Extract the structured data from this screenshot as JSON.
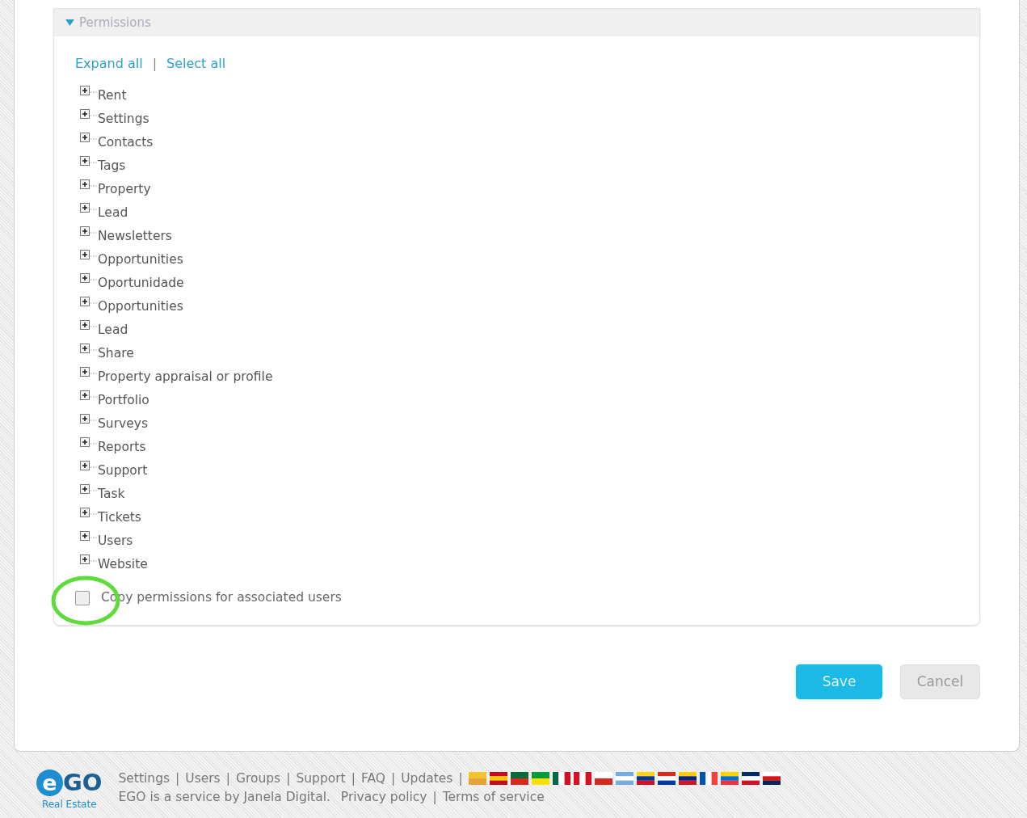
{
  "permissions_panel": {
    "title": "Permissions",
    "expanded": true,
    "actions": [
      "Expand all",
      "Select all"
    ],
    "action_separator": "|",
    "tree": [
      {
        "label": "Rent",
        "expanded": false
      },
      {
        "label": "Settings",
        "expanded": false
      },
      {
        "label": "Contacts",
        "expanded": false
      },
      {
        "label": "Tags",
        "expanded": false
      },
      {
        "label": "Property",
        "expanded": false
      },
      {
        "label": "Lead",
        "expanded": false
      },
      {
        "label": "Newsletters",
        "expanded": false
      },
      {
        "label": "Opportunities",
        "expanded": false
      },
      {
        "label": "Oportunidade",
        "expanded": false
      },
      {
        "label": "Opportunities",
        "expanded": false
      },
      {
        "label": "Lead",
        "expanded": false
      },
      {
        "label": "Share",
        "expanded": false
      },
      {
        "label": "Property appraisal or profile",
        "expanded": false
      },
      {
        "label": "Portfolio",
        "expanded": false
      },
      {
        "label": "Surveys",
        "expanded": false
      },
      {
        "label": "Reports",
        "expanded": false
      },
      {
        "label": "Support",
        "expanded": false
      },
      {
        "label": "Task",
        "expanded": false
      },
      {
        "label": "Tickets",
        "expanded": false
      },
      {
        "label": "Users",
        "expanded": false
      },
      {
        "label": "Website",
        "expanded": false
      }
    ],
    "copy_permissions": {
      "label": "Copy permissions for associated users",
      "checked": false,
      "highlighted": true
    }
  },
  "buttons": [
    {
      "label": "Save",
      "kind": "primary"
    },
    {
      "label": "Cancel",
      "kind": "secondary"
    }
  ],
  "footer": {
    "logo": {
      "mark": "e",
      "name": "GO",
      "tagline": "Real Estate"
    },
    "links": [
      "Settings",
      "Users",
      "Groups",
      "Support",
      "FAQ",
      "Updates"
    ],
    "separator": "|",
    "service_text": "EGO is a service by Janela Digital.",
    "legal_links": [
      "Privacy policy",
      "Terms of service"
    ]
  }
}
